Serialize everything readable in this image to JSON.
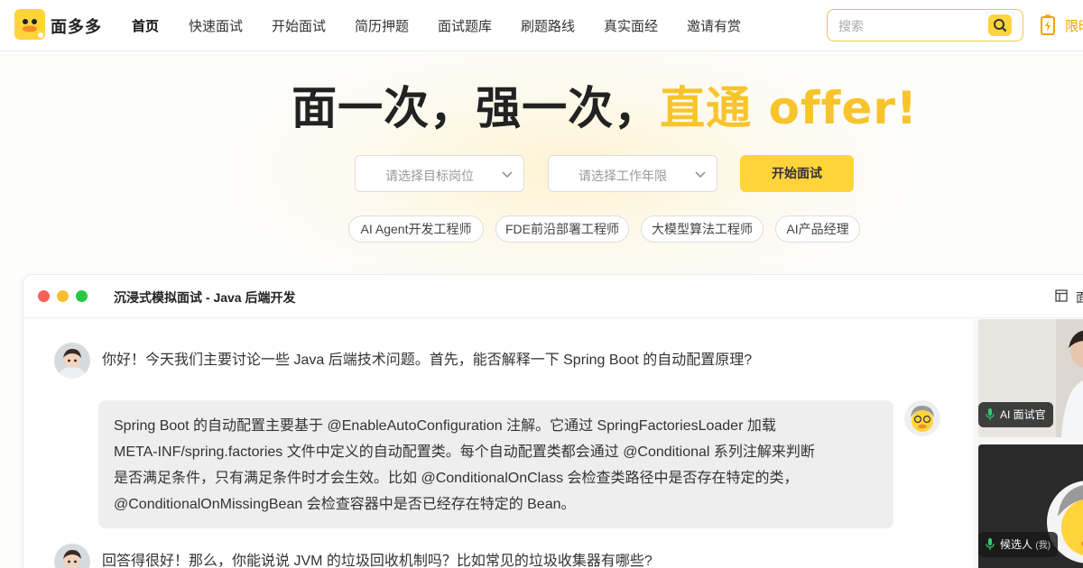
{
  "brand": {
    "name": "面多多"
  },
  "nav": {
    "items": [
      {
        "label": "首页",
        "active": true
      },
      {
        "label": "快速面试"
      },
      {
        "label": "开始面试"
      },
      {
        "label": "简历押题"
      },
      {
        "label": "面试题库"
      },
      {
        "label": "刷题路线"
      },
      {
        "label": "真实面经"
      },
      {
        "label": "邀请有赏"
      }
    ],
    "search_placeholder": "搜索",
    "promo_truncated": "限时"
  },
  "hero": {
    "title_main": "面一次，强一次，",
    "title_highlight": "直通 offer!",
    "highlight_color": "#f8c42c",
    "select_position": "请选择目标岗位",
    "select_years": "请选择工作年限",
    "start_button": "开始面试",
    "tags": [
      "AI Agent开发工程师",
      "FDE前沿部署工程师",
      "大模型算法工程师",
      "AI产品经理"
    ]
  },
  "window": {
    "title": "沉浸式模拟面试 - Java 后端开发",
    "title_truncated": "面",
    "messages": [
      {
        "role": "interviewer",
        "text": "你好！今天我们主要讨论一些 Java 后端技术问题。首先，能否解释一下 Spring Boot 的自动配置原理?"
      },
      {
        "role": "candidate",
        "lines": [
          "Spring Boot 的自动配置主要基于 @EnableAutoConfiguration 注解。它通过 SpringFactoriesLoader 加载",
          "META-INF/spring.factories 文件中定义的自动配置类。每个自动配置类都会通过 @Conditional 系列注解来判断",
          "是否满足条件，只有满足条件时才会生效。比如 @ConditionalOnClass 会检查类路径中是否存在特定的类，",
          "@ConditionalOnMissingBean 会检查容器中是否已经存在特定的 Bean。"
        ]
      },
      {
        "role": "interviewer",
        "text": "回答得很好！那么，你能说说 JVM 的垃圾回收机制吗？比如常见的垃圾收集器有哪些?"
      }
    ],
    "video_interviewer_label": "AI 面试官",
    "video_candidate_label": "候选人",
    "video_candidate_suffix": "(我)"
  },
  "colors": {
    "accent": "#ffd43b",
    "mic": "#2ecc71"
  }
}
